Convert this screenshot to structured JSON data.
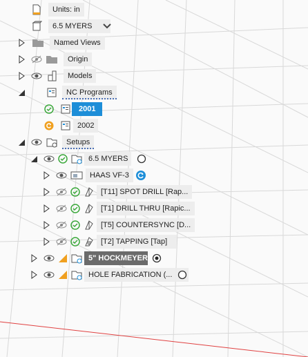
{
  "tree": {
    "units": "Units: in",
    "stock": "6.5 MYERS",
    "named_views": "Named Views",
    "origin": "Origin",
    "models": "Models",
    "nc_programs": "NC Programs",
    "nc_items": [
      "2001",
      "2002"
    ],
    "setups": "Setups",
    "setup1": {
      "label": "6.5 MYERS",
      "machine": "HAAS VF-3",
      "ops": [
        "[T11] SPOT DRILL [Rap...",
        "[T1] DRILL THRU [Rapic...",
        "[T5] COUNTERSYNC [D...",
        "[T2] TAPPING [Tap]"
      ]
    },
    "setup2": "5\" HOCKMEYER",
    "setup3": "HOLE FABRICATION (..."
  },
  "colors": {
    "selection": "#1d8ed8",
    "active_setup": "#6b6b6b",
    "check_green": "#3aa83a",
    "warning_orange": "#f0a020",
    "machine_blue": "#1d8ed8",
    "axis_red": "#e04040"
  }
}
